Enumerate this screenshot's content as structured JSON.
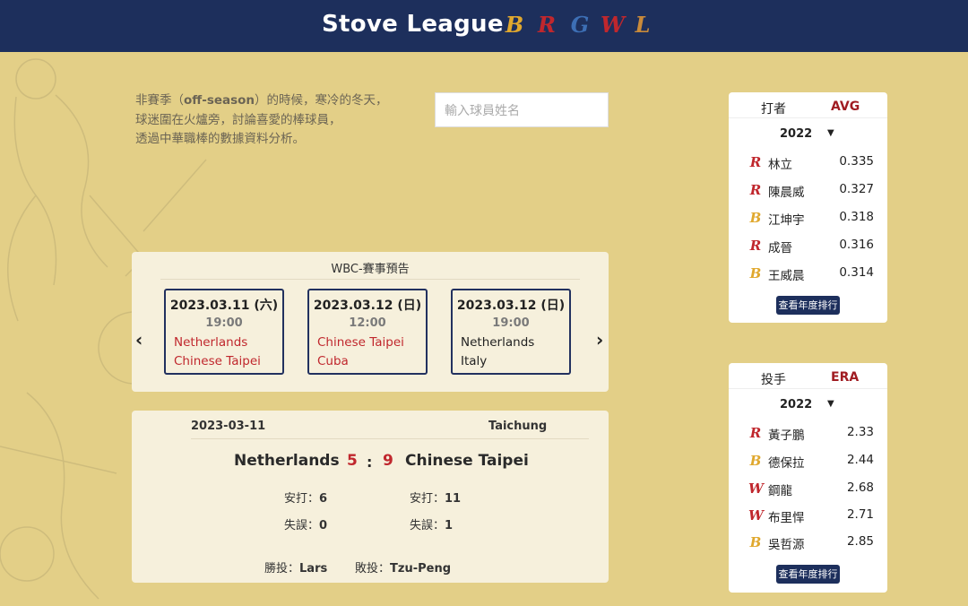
{
  "header": {
    "brand": "Stove League",
    "team_logos": [
      {
        "name": "brothers-logo",
        "glyph": "B",
        "color": "#e0a82e"
      },
      {
        "name": "lions-logo",
        "glyph": "R",
        "color": "#c0272d"
      },
      {
        "name": "guardians-logo",
        "glyph": "G",
        "color": "#3d6fb5"
      },
      {
        "name": "dragons-logo",
        "glyph": "W",
        "color": "#c0272d"
      },
      {
        "name": "monkeys-logo",
        "glyph": "L",
        "color": "#c98a3a"
      }
    ]
  },
  "intro": {
    "line1_before": "非賽季（",
    "line1_bold": "off-season",
    "line1_after": "）的時候，寒冷的冬天，",
    "line2": "球迷圍在火爐旁，討論喜愛的棒球員，",
    "line3": "透過中華職棒的數據資料分析。"
  },
  "search": {
    "placeholder": "輸入球員姓名"
  },
  "wbc": {
    "title": "WBC-賽事預告",
    "games": [
      {
        "date": "2023.03.11 (六)",
        "time": "19:00",
        "team1": "Netherlands",
        "team2": "Chinese Taipei",
        "team1_color": "red",
        "team2_color": "red"
      },
      {
        "date": "2023.03.12 (日)",
        "time": "12:00",
        "team1": "Chinese Taipei",
        "team2": "Cuba",
        "team1_color": "red",
        "team2_color": "red"
      },
      {
        "date": "2023.03.12 (日)",
        "time": "19:00",
        "team1": "Netherlands",
        "team2": "Italy",
        "team1_color": "dark",
        "team2_color": "dark"
      }
    ]
  },
  "result": {
    "date": "2023-03-11",
    "venue": "Taichung",
    "home": "Netherlands",
    "home_score": "5",
    "colon": ":",
    "away_score": "9",
    "away": "Chinese Taipei",
    "hits_label": "安打：",
    "errors_label": "失誤：",
    "home_hits": "6",
    "home_errors": "0",
    "away_hits": "11",
    "away_errors": "1",
    "win_label": "勝投：",
    "win_pitcher": "Lars",
    "loss_label": "敗投：",
    "loss_pitcher": "Tzu-Peng"
  },
  "batting": {
    "title": "打者",
    "metric": "AVG",
    "year": "2022",
    "rows": [
      {
        "logo": "lions-logo",
        "name": "林立",
        "value": "0.335"
      },
      {
        "logo": "lions-logo",
        "name": "陳晨威",
        "value": "0.327"
      },
      {
        "logo": "brothers-logo",
        "name": "江坤宇",
        "value": "0.318"
      },
      {
        "logo": "lions-logo",
        "name": "成晉",
        "value": "0.316"
      },
      {
        "logo": "brothers-logo",
        "name": "王威晨",
        "value": "0.314"
      }
    ],
    "button": "查看年度排行"
  },
  "pitching": {
    "title": "投手",
    "metric": "ERA",
    "year": "2022",
    "rows": [
      {
        "logo": "lions-logo",
        "name": "黃子鵬",
        "value": "2.33"
      },
      {
        "logo": "brothers-logo",
        "name": "德保拉",
        "value": "2.44"
      },
      {
        "logo": "dragons-logo",
        "name": "鋼龍",
        "value": "2.68"
      },
      {
        "logo": "dragons-logo",
        "name": "布里悍",
        "value": "2.71"
      },
      {
        "logo": "brothers-logo",
        "name": "吳哲源",
        "value": "2.85"
      }
    ],
    "button": "查看年度排行"
  },
  "icons": {
    "prev": "chevron-left-icon",
    "next": "chevron-right-icon",
    "caret": "caret-down-icon"
  }
}
